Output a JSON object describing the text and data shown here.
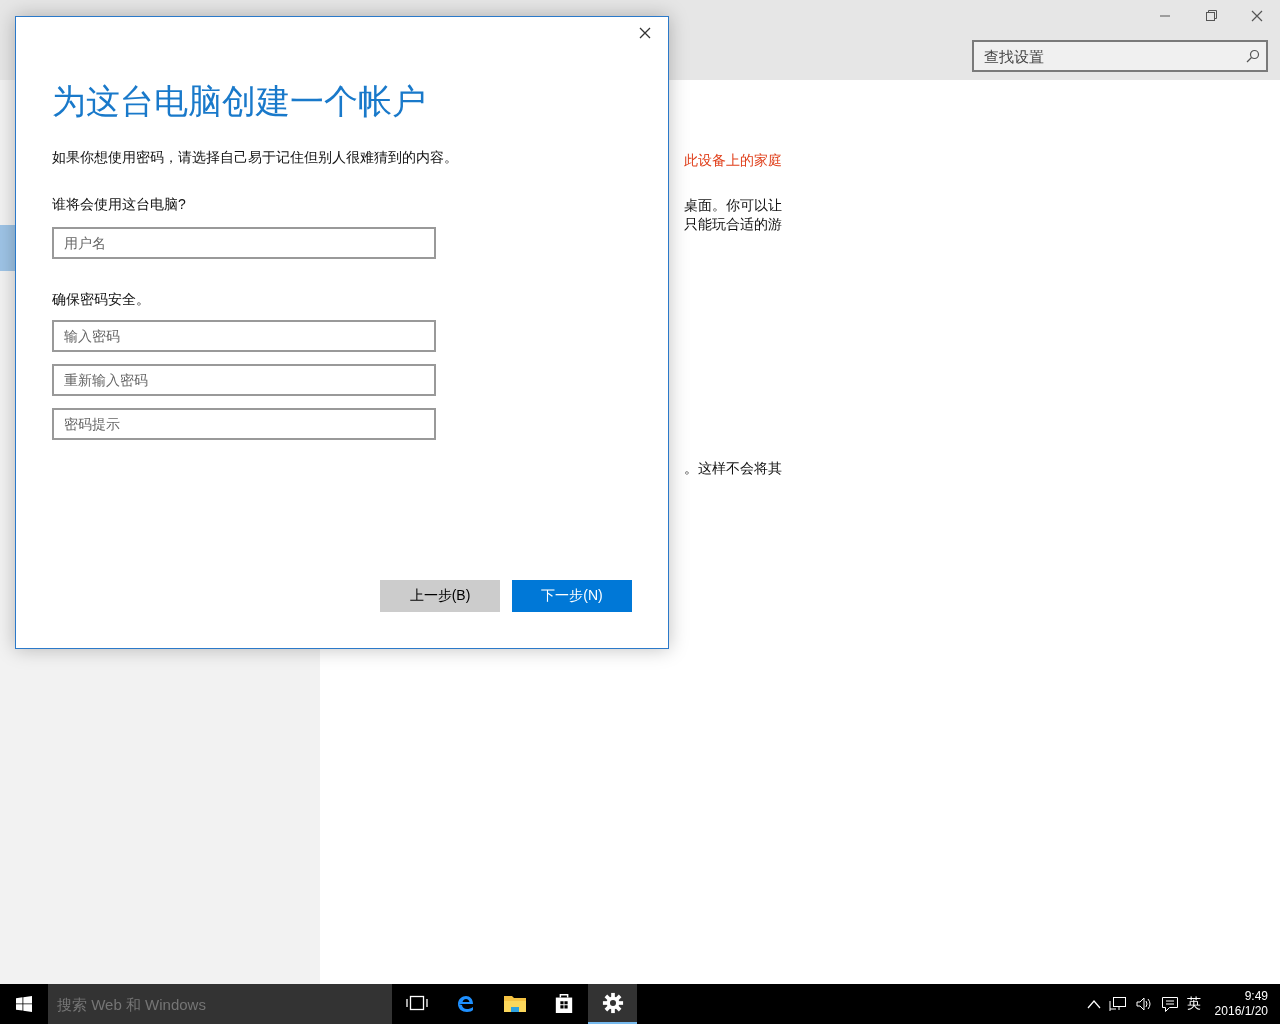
{
  "window": {
    "search": {
      "placeholder": "查找设置"
    }
  },
  "content": {
    "paragraphs": [
      {
        "kind": "link",
        "lines": [
          "此设备上的家庭"
        ]
      },
      {
        "kind": "text",
        "lines": [
          "桌面。你可以让",
          "只能玩合适的游"
        ]
      },
      {
        "kind": "text",
        "lines": [
          "。这样不会将其"
        ]
      }
    ]
  },
  "dialog": {
    "title": "为这台电脑创建一个帐户",
    "description": "如果你想使用密码，请选择自己易于记住但别人很难猜到的内容。",
    "sections": [
      {
        "label": "谁将会使用这台电脑?",
        "fields": [
          {
            "placeholder": "用户名"
          }
        ]
      },
      {
        "label": "确保密码安全。",
        "fields": [
          {
            "placeholder": "输入密码"
          },
          {
            "placeholder": "重新输入密码"
          },
          {
            "placeholder": "密码提示"
          }
        ]
      }
    ],
    "buttons": [
      {
        "label": "上一步(B)",
        "kind": "secondary"
      },
      {
        "label": "下一步(N)",
        "kind": "primary"
      }
    ]
  },
  "taskbar": {
    "search": {
      "placeholder": "搜索 Web 和 Windows"
    },
    "apps": [
      {
        "kind": "taskview",
        "selected": false
      },
      {
        "kind": "browser",
        "selected": false
      },
      {
        "kind": "folder",
        "selected": false
      },
      {
        "kind": "store",
        "selected": false
      },
      {
        "kind": "settings",
        "selected": true
      }
    ],
    "tray": {
      "language": "英",
      "time": "9:49",
      "date": "2016/1/20"
    }
  }
}
